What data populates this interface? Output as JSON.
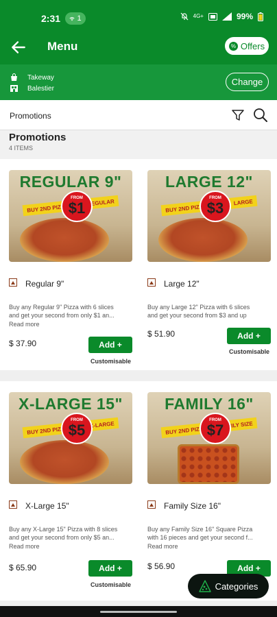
{
  "status": {
    "time": "2:31",
    "pill_count": "1",
    "network": "4G+",
    "battery": "99%"
  },
  "appbar": {
    "title": "Menu",
    "offers_label": "Offers"
  },
  "order": {
    "mode": "Takeway",
    "location": "Balestier",
    "change_label": "Change"
  },
  "filterbar": {
    "label": "Promotions"
  },
  "section": {
    "title": "Promotions",
    "count": "4 ITEMS"
  },
  "items": [
    {
      "promo_title": "REGULAR 9\"",
      "promo_tag_left": "BUY 2ND PIZZA",
      "promo_tag_right": "REGULAR",
      "promo_from": "FROM",
      "promo_price": "$1",
      "name": "Regular 9\"",
      "desc_line1": "Buy any Regular 9\" Pizza with 6 slices",
      "desc_line2": "and get your second from only $1 an...",
      "read_more": "Read more",
      "price": "$ 37.90",
      "add_label": "Add +",
      "customisable": "Customisable"
    },
    {
      "promo_title": "LARGE 12\"",
      "promo_tag_left": "BUY 2ND PIZZA",
      "promo_tag_right": "LARGE",
      "promo_from": "FROM",
      "promo_price": "$3",
      "name": "Large 12\"",
      "desc_line1": "Buy any Large 12\" Pizza with 6 slices",
      "desc_line2": "and get your second from $3 and up",
      "read_more": "",
      "price": "$ 51.90",
      "add_label": "Add +",
      "customisable": "Customisable"
    },
    {
      "promo_title": "X-LARGE 15\"",
      "promo_tag_left": "BUY 2ND PIZZA",
      "promo_tag_right": "X-LARGE",
      "promo_from": "FROM",
      "promo_price": "$5",
      "name": "X-Large 15\"",
      "desc_line1": "Buy any X-Large 15\" Pizza with 8 slices",
      "desc_line2": "and get your second from only $5 an...",
      "read_more": "Read more",
      "price": "$ 65.90",
      "add_label": "Add +",
      "customisable": "Customisable"
    },
    {
      "promo_title": "FAMILY 16\"",
      "promo_tag_left": "BUY 2ND PIZZA",
      "promo_tag_right": "FAMILY SIZE",
      "promo_from": "FROM",
      "promo_price": "$7",
      "name": "Family Size 16\"",
      "desc_line1": "Buy any Family Size 16\" Square Pizza",
      "desc_line2": "with 16 pieces and get your second f...",
      "read_more": "Read more",
      "price": "$ 56.90",
      "add_label": "Add +",
      "customisable": ""
    }
  ],
  "categories_label": "Categories",
  "colors": {
    "brand_green": "#0a8a2a",
    "promo_red": "#d9161e",
    "tag_yellow": "#f2d21b"
  }
}
